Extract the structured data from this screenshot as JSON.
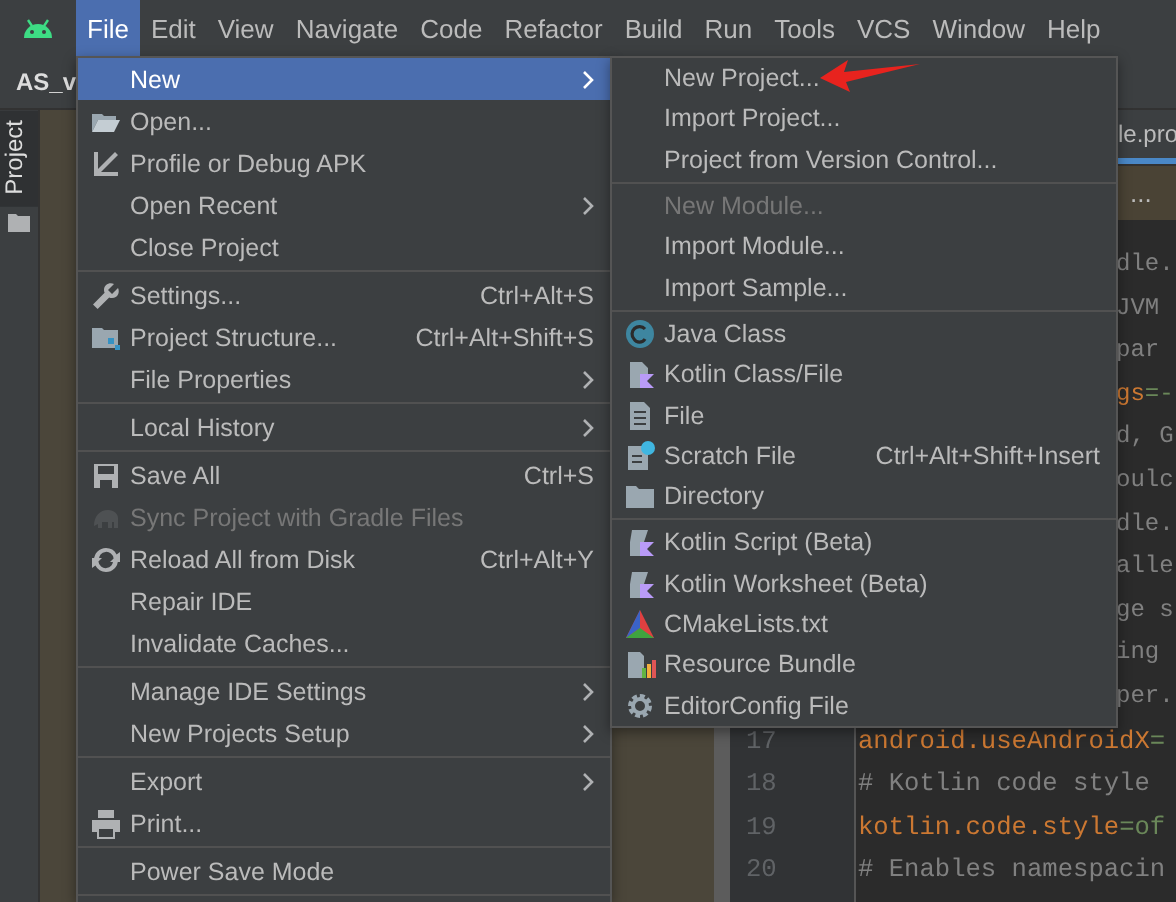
{
  "menu_bar": {
    "items": [
      {
        "label": "File",
        "selected": true
      },
      {
        "label": "Edit",
        "selected": false
      },
      {
        "label": "View",
        "selected": false
      },
      {
        "label": "Navigate",
        "selected": false
      },
      {
        "label": "Code",
        "selected": false
      },
      {
        "label": "Refactor",
        "selected": false
      },
      {
        "label": "Build",
        "selected": false
      },
      {
        "label": "Run",
        "selected": false
      },
      {
        "label": "Tools",
        "selected": false
      },
      {
        "label": "VCS",
        "selected": false
      },
      {
        "label": "Window",
        "selected": false
      },
      {
        "label": "Help",
        "selected": false
      }
    ]
  },
  "toolbar": {
    "project_name": "AS_v"
  },
  "tool_strip": {
    "tab": "Project",
    "selected": true
  },
  "editor": {
    "tab": {
      "label": "le.pro",
      "selected": true
    },
    "banner": "...",
    "lines": [
      {
        "kind": "comment",
        "text": "dle."
      },
      {
        "kind": "comment",
        "text": "JVM"
      },
      {
        "kind": "comment",
        "text": "par"
      },
      {
        "kind": "property",
        "key": "gs",
        "value": "=-"
      },
      {
        "kind": "comment",
        "text": "d, G"
      },
      {
        "kind": "comment",
        "text": "oulc"
      },
      {
        "kind": "comment",
        "text": "dle."
      },
      {
        "kind": "comment",
        "text": "alle"
      },
      {
        "kind": "comment",
        "text": "ge s"
      },
      {
        "kind": "comment",
        "text": "ing"
      },
      {
        "kind": "comment",
        "text": "per."
      },
      {
        "kind": "property",
        "number": "17",
        "key": "android.useAndroidX",
        "value": "="
      },
      {
        "kind": "comment",
        "number": "18",
        "text": "# Kotlin code style"
      },
      {
        "kind": "property",
        "number": "19",
        "key": "kotlin.code.style",
        "value": "=of"
      },
      {
        "kind": "comment",
        "number": "20",
        "text": "# Enables namespacin"
      }
    ]
  },
  "file_menu": {
    "groups": [
      [
        {
          "label": "New",
          "selected": true,
          "submenu": true,
          "disabled": false
        },
        {
          "label": "Open...",
          "selected": false,
          "submenu": false,
          "disabled": false
        },
        {
          "label": "Profile or Debug APK",
          "selected": false,
          "submenu": false,
          "disabled": false
        },
        {
          "label": "Open Recent",
          "selected": false,
          "submenu": true,
          "disabled": false
        },
        {
          "label": "Close Project",
          "selected": false,
          "submenu": false,
          "disabled": false
        }
      ],
      [
        {
          "label": "Settings...",
          "shortcut": "Ctrl+Alt+S",
          "selected": false,
          "submenu": false,
          "disabled": false
        },
        {
          "label": "Project Structure...",
          "shortcut": "Ctrl+Alt+Shift+S",
          "selected": false,
          "submenu": false,
          "disabled": false
        },
        {
          "label": "File Properties",
          "selected": false,
          "submenu": true,
          "disabled": false
        }
      ],
      [
        {
          "label": "Local History",
          "selected": false,
          "submenu": true,
          "disabled": false
        }
      ],
      [
        {
          "label": "Save All",
          "shortcut": "Ctrl+S",
          "selected": false,
          "submenu": false,
          "disabled": false
        },
        {
          "label": "Sync Project with Gradle Files",
          "selected": false,
          "submenu": false,
          "disabled": true
        },
        {
          "label": "Reload All from Disk",
          "shortcut": "Ctrl+Alt+Y",
          "selected": false,
          "submenu": false,
          "disabled": false
        },
        {
          "label": "Repair IDE",
          "selected": false,
          "submenu": false,
          "disabled": false
        },
        {
          "label": "Invalidate Caches...",
          "selected": false,
          "submenu": false,
          "disabled": false
        }
      ],
      [
        {
          "label": "Manage IDE Settings",
          "selected": false,
          "submenu": true,
          "disabled": false
        },
        {
          "label": "New Projects Setup",
          "selected": false,
          "submenu": true,
          "disabled": false
        }
      ],
      [
        {
          "label": "Export",
          "selected": false,
          "submenu": true,
          "disabled": false
        },
        {
          "label": "Print...",
          "selected": false,
          "submenu": false,
          "disabled": false
        }
      ],
      [
        {
          "label": "Power Save Mode",
          "selected": false,
          "submenu": false,
          "disabled": false
        }
      ]
    ]
  },
  "new_submenu": {
    "groups": [
      [
        {
          "label": "New Project...",
          "selected": false,
          "submenu": false,
          "disabled": false
        },
        {
          "label": "Import Project...",
          "selected": false,
          "submenu": false,
          "disabled": false
        },
        {
          "label": "Project from Version Control...",
          "selected": false,
          "submenu": false,
          "disabled": false
        }
      ],
      [
        {
          "label": "New Module...",
          "selected": false,
          "submenu": false,
          "disabled": true
        },
        {
          "label": "Import Module...",
          "selected": false,
          "submenu": false,
          "disabled": false
        },
        {
          "label": "Import Sample...",
          "selected": false,
          "submenu": false,
          "disabled": false
        }
      ],
      [
        {
          "label": "Java Class",
          "selected": false,
          "submenu": false,
          "disabled": false
        },
        {
          "label": "Kotlin Class/File",
          "selected": false,
          "submenu": false,
          "disabled": false
        },
        {
          "label": "File",
          "selected": false,
          "submenu": false,
          "disabled": false
        },
        {
          "label": "Scratch File",
          "shortcut": "Ctrl+Alt+Shift+Insert",
          "selected": false,
          "submenu": false,
          "disabled": false
        },
        {
          "label": "Directory",
          "selected": false,
          "submenu": false,
          "disabled": false
        }
      ],
      [
        {
          "label": "Kotlin Script (Beta)",
          "selected": false,
          "submenu": false,
          "disabled": false
        },
        {
          "label": "Kotlin Worksheet (Beta)",
          "selected": false,
          "submenu": false,
          "disabled": false
        },
        {
          "label": "CMakeLists.txt",
          "selected": false,
          "submenu": false,
          "disabled": false
        },
        {
          "label": "Resource Bundle",
          "selected": false,
          "submenu": false,
          "disabled": false
        },
        {
          "label": "EditorConfig File",
          "selected": false,
          "submenu": false,
          "disabled": false
        }
      ]
    ]
  }
}
